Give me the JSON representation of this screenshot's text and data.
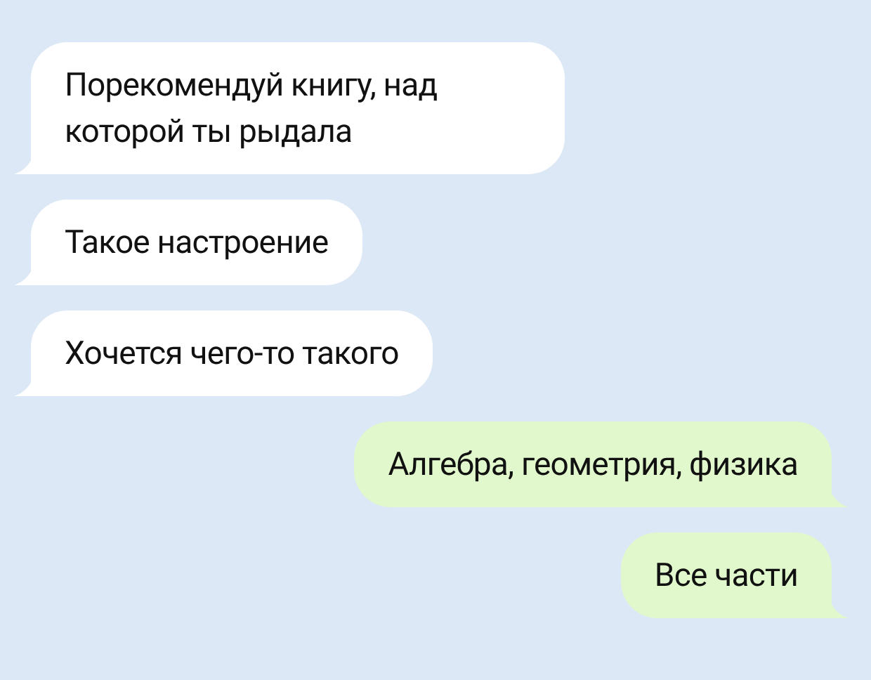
{
  "messages": [
    {
      "kind": "incoming",
      "text": "Порекомендуй книгу, над которой ты рыдала"
    },
    {
      "kind": "incoming",
      "text": "Такое настроение"
    },
    {
      "kind": "incoming",
      "text": "Хочется чего-то такого"
    },
    {
      "kind": "outgoing",
      "text": "Алгебра, геометрия, физика"
    },
    {
      "kind": "outgoing",
      "text": "Все части"
    }
  ]
}
